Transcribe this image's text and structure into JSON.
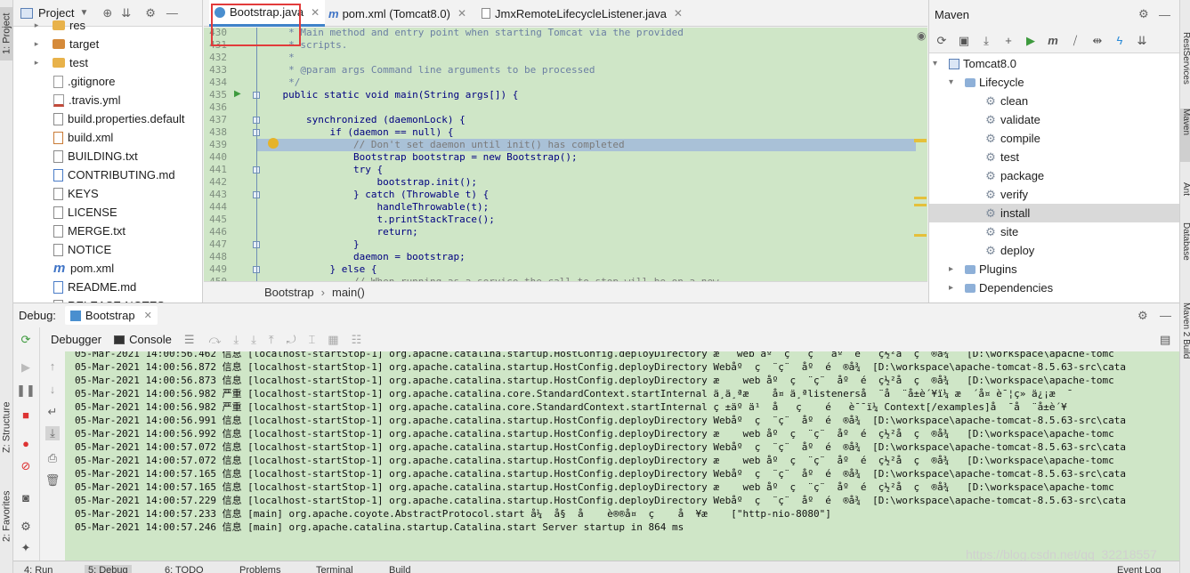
{
  "left_strip": {
    "project_tab": "1: Project",
    "structure_tab": "Z: Structure",
    "favorites_tab": "2: Favorites"
  },
  "right_strip": {
    "tabs": [
      "RestServices",
      "Maven",
      "Ant",
      "Database",
      "Maven 2 Build"
    ]
  },
  "project_panel": {
    "title": "Project",
    "items": [
      {
        "label": "res",
        "type": "folder",
        "arrow": "▸"
      },
      {
        "label": "target",
        "type": "folder-orange",
        "arrow": "▸"
      },
      {
        "label": "test",
        "type": "folder",
        "arrow": "▸"
      },
      {
        "label": ".gitignore",
        "type": "git"
      },
      {
        "label": ".travis.yml",
        "type": "yml"
      },
      {
        "label": "build.properties.default",
        "type": "doc"
      },
      {
        "label": "build.xml",
        "type": "xml"
      },
      {
        "label": "BUILDING.txt",
        "type": "doc"
      },
      {
        "label": "CONTRIBUTING.md",
        "type": "md"
      },
      {
        "label": "KEYS",
        "type": "doc"
      },
      {
        "label": "LICENSE",
        "type": "doc"
      },
      {
        "label": "MERGE.txt",
        "type": "doc"
      },
      {
        "label": "NOTICE",
        "type": "doc"
      },
      {
        "label": "pom.xml",
        "type": "maven"
      },
      {
        "label": "README.md",
        "type": "md"
      },
      {
        "label": "RELEASE-NOTES",
        "type": "doc"
      }
    ]
  },
  "editor_tabs": [
    {
      "label": "Bootstrap.java",
      "active": true
    },
    {
      "label": "pom.xml (Tomcat8.0)",
      "active": false
    },
    {
      "label": "JmxRemoteLifecycleListener.java",
      "active": false
    }
  ],
  "editor": {
    "lines": [
      {
        "num": "430",
        "text": "     * Main method and entry point when starting Tomcat via the provided",
        "cls": "c-comment"
      },
      {
        "num": "431",
        "text": "     * scripts.",
        "cls": "c-comment"
      },
      {
        "num": "432",
        "text": "     *",
        "cls": "c-comment"
      },
      {
        "num": "433",
        "text": "     * @param args Command line arguments to be processed",
        "cls": "c-comment"
      },
      {
        "num": "434",
        "text": "     */",
        "cls": "c-comment"
      },
      {
        "num": "435",
        "text": "    public static void main(String args[]) {",
        "cls": "c-kw"
      },
      {
        "num": "436",
        "text": "",
        "cls": ""
      },
      {
        "num": "437",
        "text": "        synchronized (daemonLock) {",
        "cls": "c-kw"
      },
      {
        "num": "438",
        "text": "            if (daemon == null) {",
        "cls": "c-kw"
      },
      {
        "num": "439",
        "text": "                // Don't set daemon until init() has completed",
        "cls": "c-cmt"
      },
      {
        "num": "440",
        "text": "                Bootstrap bootstrap = new Bootstrap();",
        "cls": "c-kw"
      },
      {
        "num": "441",
        "text": "                try {",
        "cls": "c-kw"
      },
      {
        "num": "442",
        "text": "                    bootstrap.init();",
        "cls": "c-kw"
      },
      {
        "num": "443",
        "text": "                } catch (Throwable t) {",
        "cls": "c-kw"
      },
      {
        "num": "444",
        "text": "                    handleThrowable(t);",
        "cls": "c-kw"
      },
      {
        "num": "445",
        "text": "                    t.printStackTrace();",
        "cls": "c-kw"
      },
      {
        "num": "446",
        "text": "                    return;",
        "cls": "c-kw"
      },
      {
        "num": "447",
        "text": "                }",
        "cls": "c-kw"
      },
      {
        "num": "448",
        "text": "                daemon = bootstrap;",
        "cls": "c-kw"
      },
      {
        "num": "449",
        "text": "            } else {",
        "cls": "c-kw"
      },
      {
        "num": "450",
        "text": "                // When running as a service the call to stop will be on a new",
        "cls": "c-cmt"
      }
    ],
    "breadcrumb": [
      "Bootstrap",
      "main()"
    ],
    "breadcrumb_sep": "›"
  },
  "maven_panel": {
    "title": "Maven",
    "items": [
      {
        "label": "Tomcat8.0",
        "kind": "root",
        "arrow": "▾"
      },
      {
        "label": "Lifecycle",
        "kind": "lifecycle",
        "arrow": "▾"
      },
      {
        "label": "clean",
        "kind": "goal"
      },
      {
        "label": "validate",
        "kind": "goal"
      },
      {
        "label": "compile",
        "kind": "goal"
      },
      {
        "label": "test",
        "kind": "goal"
      },
      {
        "label": "package",
        "kind": "goal"
      },
      {
        "label": "verify",
        "kind": "goal"
      },
      {
        "label": "install",
        "kind": "goal",
        "selected": true
      },
      {
        "label": "site",
        "kind": "goal"
      },
      {
        "label": "deploy",
        "kind": "goal"
      },
      {
        "label": "Plugins",
        "kind": "group",
        "arrow": "▸"
      },
      {
        "label": "Dependencies",
        "kind": "group",
        "arrow": "▸"
      }
    ]
  },
  "debug": {
    "label": "Debug:",
    "session_tab": "Bootstrap",
    "debugger_tab": "Debugger",
    "console_tab": "Console",
    "log_lines": [
      "05-Mar-2021 14:00:56.462 信息 [localhost-startStop-1] org.apache.catalina.startup.HostConfig.deployDirectory æ   web åº  ç   ç   åº  é   ç½²ä  ç  ®å¾   [D:\\workspace\\apache-tomc",
      "05-Mar-2021 14:00:56.872 信息 [localhost-startStop-1] org.apache.catalina.startup.HostConfig.deployDirectory Webåº  ç  ¨ç¨  åº  é  ®å¾  [D:\\workspace\\apache-tomcat-8.5.63-src\\cata",
      "05-Mar-2021 14:00:56.873 信息 [localhost-startStop-1] org.apache.catalina.startup.HostConfig.deployDirectory æ    web åº  ç  ¨ç¨  åº  é  ç½²å  ç  ®å¾   [D:\\workspace\\apache-tomc",
      "05-Mar-2021 14:00:56.982 严重 [localhost-startStop-1] org.apache.catalina.core.StandardContext.startInternal ä¸ä¸ªæ    å¤ ä¸ªlistenerså  ¨å  ¨å±è´¥ï¼ æ  ´å¤ è¯¦ç» ä¿¡æ  ¯",
      "05-Mar-2021 14:00:56.982 严重 [localhost-startStop-1] org.apache.catalina.core.StandardContext.startInternal ç ±äº ä¹  å   ç    é   è¯¯ï¼ Context[/examples]å  ¯å  ¨å±è´¥",
      "05-Mar-2021 14:00:56.991 信息 [localhost-startStop-1] org.apache.catalina.startup.HostConfig.deployDirectory Webåº  ç  ¨ç¨  åº  é  ®å¾  [D:\\workspace\\apache-tomcat-8.5.63-src\\cata",
      "05-Mar-2021 14:00:56.992 信息 [localhost-startStop-1] org.apache.catalina.startup.HostConfig.deployDirectory æ    web åº  ç  ¨ç¨  åº  é  ç½²å  ç  ®å¾   [D:\\workspace\\apache-tomc",
      "05-Mar-2021 14:00:57.072 信息 [localhost-startStop-1] org.apache.catalina.startup.HostConfig.deployDirectory Webåº  ç  ¨ç¨  åº  é  ®å¾  [D:\\workspace\\apache-tomcat-8.5.63-src\\cata",
      "05-Mar-2021 14:00:57.072 信息 [localhost-startStop-1] org.apache.catalina.startup.HostConfig.deployDirectory æ    web åº  ç  ¨ç¨  åº  é  ç½²å  ç  ®å¾   [D:\\workspace\\apache-tomc",
      "05-Mar-2021 14:00:57.165 信息 [localhost-startStop-1] org.apache.catalina.startup.HostConfig.deployDirectory Webåº  ç  ¨ç¨  åº  é  ®å¾  [D:\\workspace\\apache-tomcat-8.5.63-src\\cata",
      "05-Mar-2021 14:00:57.165 信息 [localhost-startStop-1] org.apache.catalina.startup.HostConfig.deployDirectory æ    web åº  ç  ¨ç¨  åº  é  ç½²å  ç  ®å¾   [D:\\workspace\\apache-tomc",
      "05-Mar-2021 14:00:57.229 信息 [localhost-startStop-1] org.apache.catalina.startup.HostConfig.deployDirectory Webåº  ç  ¨ç¨  åº  é  ®å¾  [D:\\workspace\\apache-tomcat-8.5.63-src\\cata",
      "05-Mar-2021 14:00:57.233 信息 [main] org.apache.coyote.AbstractProtocol.start å¼  å§  å    è®®å¤  ç    å  ¥æ    [\"http-nio-8080\"]",
      "05-Mar-2021 14:00:57.246 信息 [main] org.apache.catalina.startup.Catalina.start Server startup in 864 ms"
    ]
  },
  "watermark": "https://blog.csdn.net/qq_32218557",
  "bottom_bar": {
    "tabs": [
      "4: Run",
      "5: Debug",
      "6: TODO",
      "Problems",
      "Terminal",
      "Build"
    ],
    "event_log": "Event Log"
  },
  "colors": {
    "editor_bg": "#cfe6c7",
    "tab_highlight": "#e23b3b",
    "accent": "#4083c9"
  }
}
